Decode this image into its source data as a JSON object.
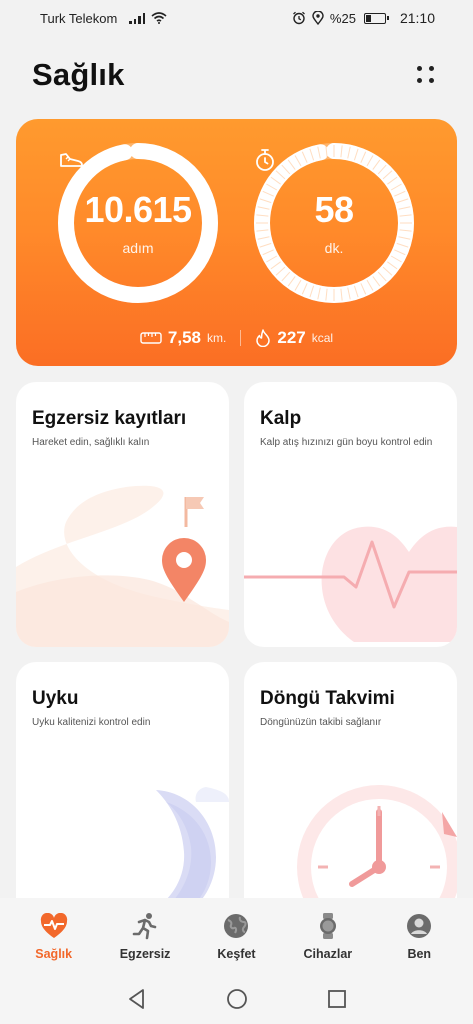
{
  "status_bar": {
    "carrier": "Turk Telekom",
    "battery_percent": "%25",
    "time": "21:10",
    "battery_level": 0.25
  },
  "header": {
    "title": "Sağlık",
    "menu_icon": "dots-grid-icon"
  },
  "activity": {
    "steps_value": "10.615",
    "steps_unit": "adım",
    "steps_icon": "shoe-icon",
    "steps_progress": 0.97,
    "minutes_value": "58",
    "minutes_unit": "dk.",
    "minutes_icon": "stopwatch-icon",
    "minutes_progress": 0.97,
    "distance_value": "7,58",
    "distance_unit": "km.",
    "calories_value": "227",
    "calories_unit": "kcal",
    "colors": {
      "start": "#ff9a2e",
      "end": "#fb6e24"
    }
  },
  "cards": {
    "exercise": {
      "title": "Egzersiz kayıtları",
      "subtitle": "Hareket edin, sağlıklı kalın"
    },
    "heart": {
      "title": "Kalp",
      "subtitle": "Kalp atış hızınızı gün boyu kontrol edin"
    },
    "sleep": {
      "title": "Uyku",
      "subtitle": "Uyku kalitenizi kontrol edin"
    },
    "cycle": {
      "title": "Döngü Takvimi",
      "subtitle": "Döngünüzün takibi sağlanır"
    }
  },
  "nav": {
    "items": [
      {
        "label": "Sağlık",
        "icon": "heart-pulse-icon",
        "active": true
      },
      {
        "label": "Egzersiz",
        "icon": "runner-icon",
        "active": false
      },
      {
        "label": "Keşfet",
        "icon": "globe-icon",
        "active": false
      },
      {
        "label": "Cihazlar",
        "icon": "watch-icon",
        "active": false
      },
      {
        "label": "Ben",
        "icon": "profile-icon",
        "active": false
      }
    ],
    "accent": "#f2682b"
  }
}
